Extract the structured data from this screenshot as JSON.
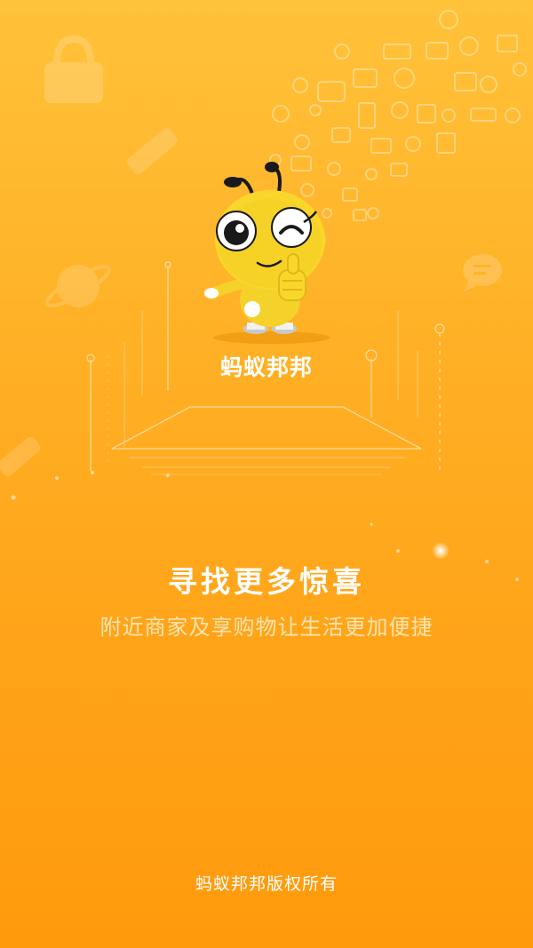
{
  "splash": {
    "brand_name": "蚂蚁邦邦",
    "headline": "寻找更多惊喜",
    "subline": "附近商家及享购物让生活更加便捷",
    "copyright": "蚂蚁邦邦版权所有"
  },
  "icons": {
    "mascot": "ant-mascot-thumbs-up-icon",
    "decor": [
      "shopping-bag-icon",
      "rocket-icon",
      "planet-icon",
      "chat-bubble-icon",
      "social-media-icons-cluster"
    ]
  },
  "colors": {
    "background_top": "#ffc23a",
    "background_bottom": "#ff9a0c",
    "text_primary": "#ffffff",
    "text_secondary": "#ffe4b0",
    "mascot_yellow": "#f9d72a"
  }
}
